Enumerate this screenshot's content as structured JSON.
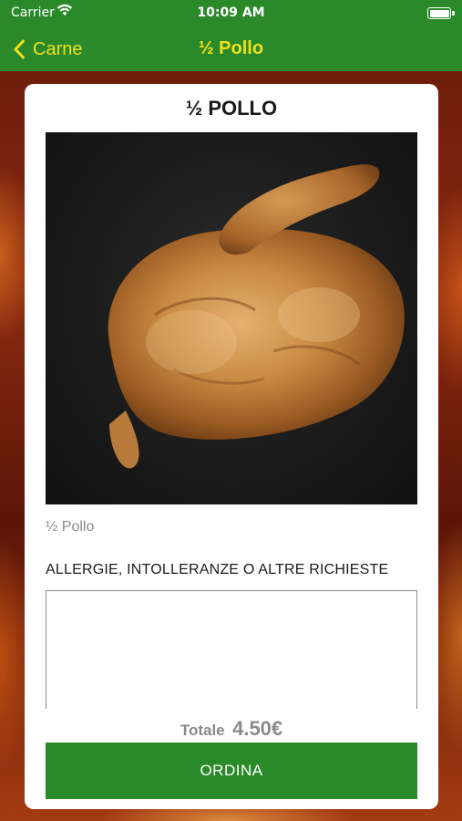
{
  "status_bar": {
    "carrier": "Carrier",
    "time": "10:09 AM"
  },
  "nav": {
    "back_label": "Carne",
    "title": "½ Pollo"
  },
  "product": {
    "name": "½ POLLO",
    "description": "½ Pollo",
    "image_icon": "roast-half-chicken-photo"
  },
  "notes": {
    "label": "ALLERGIE, INTOLLERANZE O ALTRE RICHIESTE",
    "value": "",
    "placeholder": ""
  },
  "order": {
    "total_label": "Totale",
    "total_value": "4.50€",
    "button_label": "ORDINA"
  },
  "colors": {
    "brand_green": "#2a8a2a",
    "accent_yellow": "#f2e01c"
  }
}
